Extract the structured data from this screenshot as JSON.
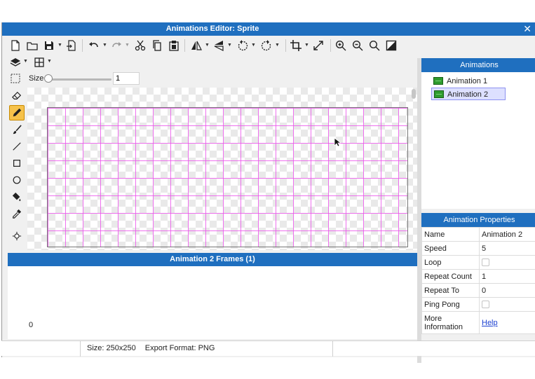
{
  "window": {
    "title": "Animations Editor: Sprite",
    "close_glyph": "✕"
  },
  "toolbar": {
    "icons": [
      "new-file-icon",
      "open-folder-icon",
      "save-icon",
      "export-icon",
      "undo-icon",
      "redo-icon",
      "cut-icon",
      "copy-icon",
      "paste-icon",
      "flip-horizontal-icon",
      "flip-vertical-icon",
      "rotate-left-icon",
      "rotate-right-icon",
      "crop-icon",
      "resize-icon",
      "zoom-in-icon",
      "zoom-out-icon",
      "zoom-fit-icon",
      "toggle-background-icon",
      "layers-icon",
      "grid-icon"
    ]
  },
  "size_control": {
    "label": "Size",
    "value": "1",
    "slider_fraction": 0.0
  },
  "left_tools": [
    "eraser-icon",
    "pencil-icon",
    "brush-icon",
    "line-icon",
    "rectangle-icon",
    "ellipse-icon",
    "fill-bucket-icon",
    "eyedropper-icon",
    "pan-icon"
  ],
  "frames": {
    "title": "Animation 2 Frames (1)",
    "frame_index": "0"
  },
  "status": {
    "size_text": "Size: 250x250",
    "export_text": "Export Format: PNG"
  },
  "animations": {
    "header": "Animations",
    "items": [
      {
        "label": "Animation 1",
        "selected": false
      },
      {
        "label": "Animation 2",
        "selected": true
      }
    ]
  },
  "properties": {
    "header": "Animation Properties",
    "rows": [
      {
        "key": "Name",
        "value": "Animation 2"
      },
      {
        "key": "Speed",
        "value": "5"
      },
      {
        "key": "Loop",
        "value": "",
        "checkbox": true,
        "checked": false
      },
      {
        "key": "Repeat Count",
        "value": "1"
      },
      {
        "key": "Repeat To",
        "value": "0"
      },
      {
        "key": "Ping Pong",
        "value": "",
        "checkbox": true,
        "checked": false
      },
      {
        "key": "More Information",
        "value": "Help",
        "link": true
      }
    ]
  },
  "colors": {
    "accent": "#1f6fbf",
    "grid_line": "#ec58ec",
    "active_tool": "#f6c24a",
    "selection": "#dde0ff"
  }
}
